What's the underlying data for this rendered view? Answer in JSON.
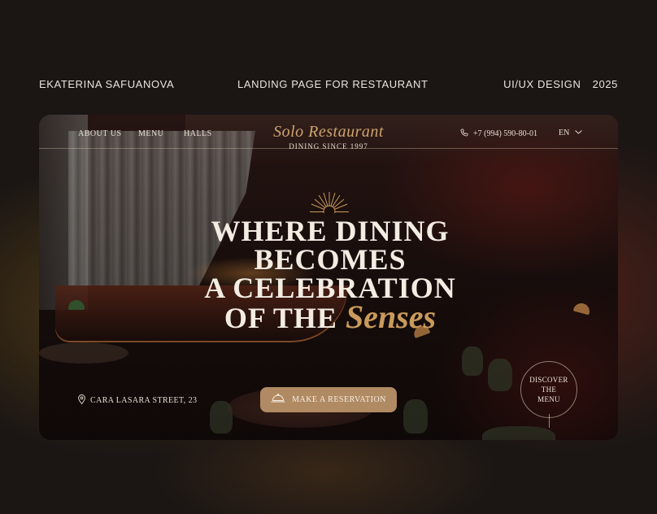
{
  "header": {
    "author": "EKATERINA SAFUANOVA",
    "project": "LANDING PAGE FOR RESTAURANT",
    "discipline": "UI/UX DESIGN",
    "year": "2025"
  },
  "site": {
    "nav": {
      "items": [
        {
          "label": "ABOUT US"
        },
        {
          "label": "MENU"
        },
        {
          "label": "HALLS"
        }
      ]
    },
    "logo": {
      "name": "Solo Restaurant",
      "tagline": "DINING SINCE 1997"
    },
    "phone": {
      "icon": "phone-icon",
      "number": "+7 (994)  590-80-01"
    },
    "language": {
      "selected": "EN",
      "icon": "chevron-down-icon"
    },
    "hero": {
      "ornament": "sunburst-icon",
      "headline_lines": [
        "WHERE DINING",
        "BECOMES",
        "A CELEBRATION",
        "OF THE"
      ],
      "headline_script": "Senses"
    },
    "address": {
      "icon": "location-pin-icon",
      "text": "CARA LASARA STREET, 23"
    },
    "reservation_button": {
      "icon": "cloche-icon",
      "label": "MAKE A RESERVATION"
    },
    "discover": {
      "lines": [
        "DISCOVER",
        "THE",
        "MENU"
      ]
    },
    "colors": {
      "accent_gold": "#c99a5c",
      "button_bg": "#b08a63",
      "page_bg": "#1b1614"
    }
  }
}
